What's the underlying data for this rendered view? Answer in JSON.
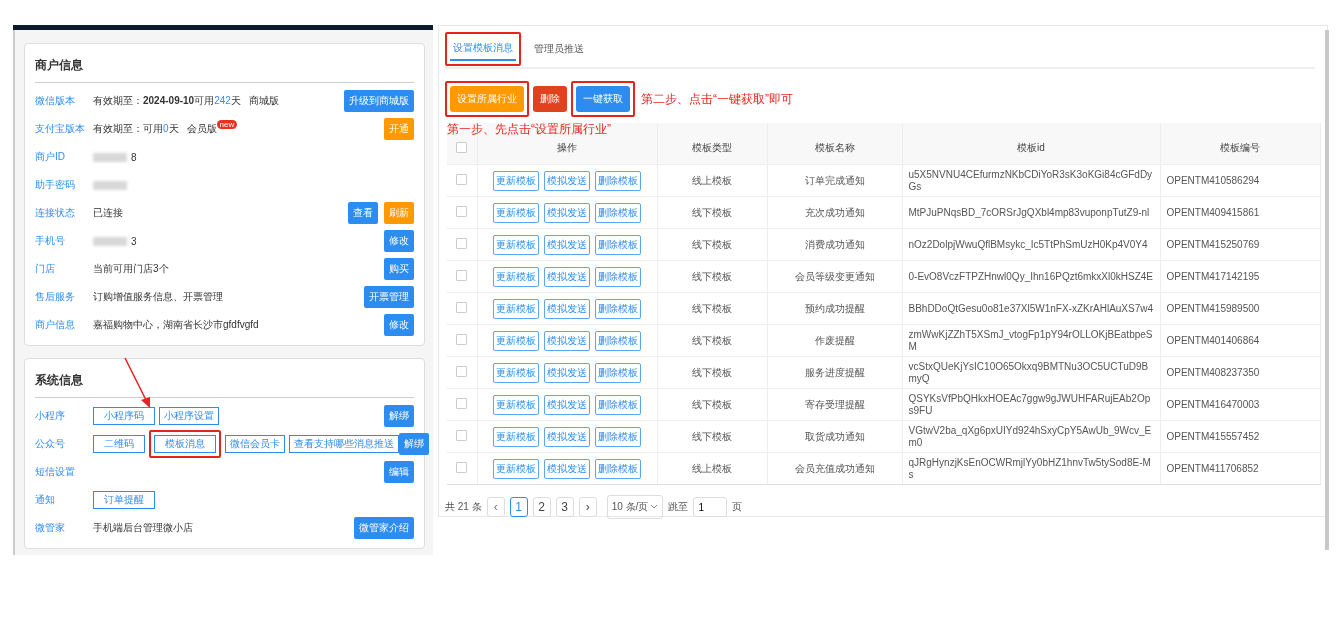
{
  "merchant_card": {
    "title": "商户信息",
    "rows": [
      {
        "label": "微信版本",
        "segments": [
          {
            "text": "有效期至：",
            "kind": "plain"
          },
          {
            "text": "2024-09-10",
            "kind": "bold"
          },
          {
            "text": "可用",
            "kind": "plain"
          },
          {
            "text": "242",
            "kind": "highlight"
          },
          {
            "text": "天",
            "kind": "plain"
          },
          {
            "text": "商城版",
            "kind": "gap"
          }
        ],
        "actions": [
          {
            "label": "升级到商城版",
            "kind": "primary"
          }
        ]
      },
      {
        "label": "支付宝版本",
        "segments": [
          {
            "text": "有效期至：可用",
            "kind": "plain"
          },
          {
            "text": "0",
            "kind": "highlight"
          },
          {
            "text": "天",
            "kind": "plain"
          },
          {
            "text": "会员版",
            "kind": "gap"
          }
        ],
        "badge": "new",
        "actions": [
          {
            "label": "开通",
            "kind": "warning"
          }
        ]
      },
      {
        "label": "商户ID",
        "blurred": true,
        "visible_end": "8"
      },
      {
        "label": "助手密码",
        "blurred": true
      },
      {
        "label": "连接状态",
        "segments": [
          {
            "text": "已连接",
            "kind": "plain"
          }
        ],
        "actions": [
          {
            "label": "查看",
            "kind": "primary"
          },
          {
            "label": "刷新",
            "kind": "warning"
          }
        ]
      },
      {
        "label": "手机号",
        "blurred": true,
        "visible_end": "3",
        "actions": [
          {
            "label": "修改",
            "kind": "primary"
          }
        ]
      },
      {
        "label": "门店",
        "segments": [
          {
            "text": "当前可用门店3个",
            "kind": "plain"
          }
        ],
        "actions": [
          {
            "label": "购买",
            "kind": "primary"
          }
        ]
      },
      {
        "label": "售后服务",
        "segments": [
          {
            "text": "订购增值服务信息、开票管理",
            "kind": "plain"
          }
        ],
        "actions": [
          {
            "label": "开票管理",
            "kind": "primary"
          }
        ]
      },
      {
        "label": "商户信息",
        "segments": [
          {
            "text": "嘉福购物中心，湖南省长沙市gfdfvgfd",
            "kind": "plain"
          }
        ],
        "actions": [
          {
            "label": "修改",
            "kind": "primary"
          }
        ]
      }
    ]
  },
  "system_card": {
    "title": "系统信息",
    "rows": [
      {
        "label": "小程序",
        "tags": [
          {
            "label": "小程序码",
            "annotated": false
          },
          {
            "label": "小程序设置",
            "annotated": false
          }
        ],
        "actions": [
          {
            "label": "解绑",
            "kind": "primary"
          }
        ]
      },
      {
        "label": "公众号",
        "tags": [
          {
            "label": "二维码",
            "annotated": false
          },
          {
            "label": "模板消息",
            "annotated": true
          },
          {
            "label": "微信会员卡",
            "annotated": false
          },
          {
            "label": "查看支持哪些消息推送",
            "annotated": false
          }
        ],
        "actions": [
          {
            "label": "解绑",
            "kind": "primary"
          }
        ]
      },
      {
        "label": "短信设置",
        "actions": [
          {
            "label": "编辑",
            "kind": "primary"
          }
        ]
      },
      {
        "label": "通知",
        "tags": [
          {
            "label": "订单提醒",
            "annotated": false
          }
        ]
      },
      {
        "label": "微管家",
        "segments": [
          {
            "text": "手机端后台管理微小店",
            "kind": "plain"
          }
        ],
        "actions": [
          {
            "label": "微管家介绍",
            "kind": "primary"
          }
        ]
      }
    ]
  },
  "tabs": [
    {
      "label": "设置模板消息",
      "selected": true,
      "annotated": true
    },
    {
      "label": "管理员推送",
      "selected": false,
      "annotated": false
    }
  ],
  "toolbar": [
    {
      "label": "设置所属行业",
      "kind": "warning",
      "annotated": true
    },
    {
      "label": "删除",
      "kind": "danger",
      "annotated": false
    },
    {
      "label": "一键获取",
      "kind": "primary",
      "annotated": true
    }
  ],
  "annotations": {
    "step_two": "第二步、点击“一键获取”即可",
    "step_one": "第一步、先点击“设置所属行业”"
  },
  "table": {
    "header_checked": false,
    "columns": [
      "操作",
      "模板类型",
      "模板名称",
      "模板id",
      "模板编号"
    ],
    "rows": [
      {
        "checked": false,
        "actions": [
          "更新模板",
          "模拟发送",
          "删除模板"
        ],
        "type": "线上模板",
        "name": "订单完成通知",
        "id": "u5X5NVNU4CEfurmzNKbCDiYoR3sK3oKGi84cGFdDyGs",
        "number": "OPENTM410586294"
      },
      {
        "checked": false,
        "actions": [
          "更新模板",
          "模拟发送",
          "删除模板"
        ],
        "type": "线下模板",
        "name": "充次成功通知",
        "id": "MtPJuPNqsBD_7cORSrJgQXbl4mp83vuponpTutZ9-nl",
        "number": "OPENTM409415861"
      },
      {
        "checked": false,
        "actions": [
          "更新模板",
          "模拟发送",
          "删除模板"
        ],
        "type": "线下模板",
        "name": "消费成功通知",
        "id": "nOz2DolpjWwuQflBMsykc_Ic5TtPhSmUzH0Kp4V0Y4",
        "number": "OPENTM415250769"
      },
      {
        "checked": false,
        "actions": [
          "更新模板",
          "模拟发送",
          "删除模板"
        ],
        "type": "线下模板",
        "name": "会员等级变更通知",
        "id": "0-EvO8VczFTPZHnwl0Qy_Ihn16PQzt6mkxXl0kHSZ4E",
        "number": "OPENTM417142195"
      },
      {
        "checked": false,
        "actions": [
          "更新模板",
          "模拟发送",
          "删除模板"
        ],
        "type": "线下模板",
        "name": "预约成功提醒",
        "id": "BBhDDoQtGesu0o81e37Xl5W1nFX-xZKrAHlAuXS7w4",
        "number": "OPENTM415989500"
      },
      {
        "checked": false,
        "actions": [
          "更新模板",
          "模拟发送",
          "删除模板"
        ],
        "type": "线下模板",
        "name": "作废提醒",
        "id": "zmWwKjZZhT5XSmJ_vtogFp1pY94rOLLOKjBEatbpeSM",
        "number": "OPENTM401406864"
      },
      {
        "checked": false,
        "actions": [
          "更新模板",
          "模拟发送",
          "删除模板"
        ],
        "type": "线下模板",
        "name": "服务进度提醒",
        "id": "vcStxQUeKjYsIC10O65Okxq9BMTNu3OC5UCTuD9BmyQ",
        "number": "OPENTM408237350"
      },
      {
        "checked": false,
        "actions": [
          "更新模板",
          "模拟发送",
          "删除模板"
        ],
        "type": "线下模板",
        "name": "寄存受理提醒",
        "id": "QSYKsVfPbQHkxHOEAc7ggw9gJWUHFARujEAb2Ops9FU",
        "number": "OPENTM416470003"
      },
      {
        "checked": false,
        "actions": [
          "更新模板",
          "模拟发送",
          "删除模板"
        ],
        "type": "线下模板",
        "name": "取货成功通知",
        "id": "VGtwV2ba_qXg6pxUIYd924hSxyCpY5AwUb_9Wcv_Em0",
        "number": "OPENTM415557452"
      },
      {
        "checked": false,
        "actions": [
          "更新模板",
          "模拟发送",
          "删除模板"
        ],
        "type": "线上模板",
        "name": "会员充值成功通知",
        "id": "qJRgHynzjKsEnOCWRmjlYy0bHZ1hnvTw5tySod8E-Ms",
        "number": "OPENTM411706852"
      }
    ]
  },
  "pagination": {
    "total": "共 21 条",
    "prev": "‹",
    "pages": [
      {
        "label": "1",
        "selected": true
      },
      {
        "label": "2",
        "selected": false
      },
      {
        "label": "3",
        "selected": false
      }
    ],
    "next": "›",
    "page_size": "10 条/页",
    "jump_label": "跳至",
    "jump_value": "1",
    "page_unit": "页"
  }
}
